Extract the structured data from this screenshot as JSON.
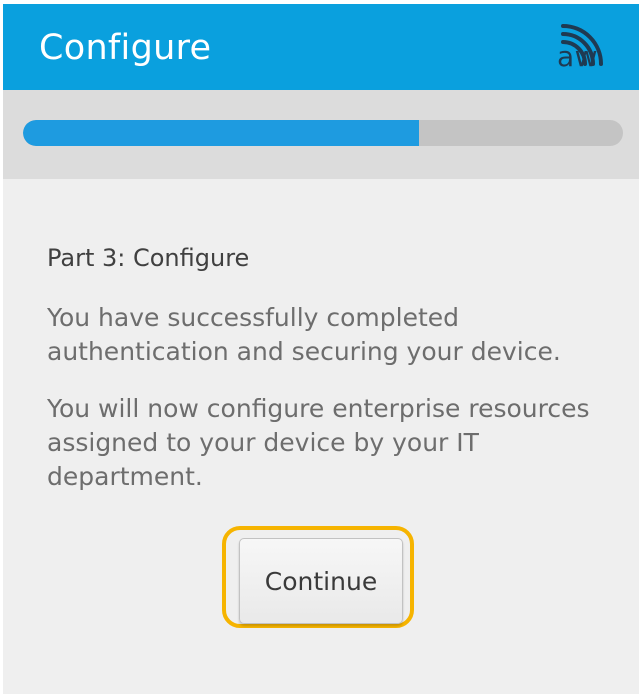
{
  "appbar": {
    "title": "Configure",
    "logo_text": "aw",
    "logo_icon": "airwatch-wifi-logo",
    "background_color": "#0aa0de"
  },
  "progress": {
    "value_fraction": 0.66,
    "fill_color": "#1e9be0",
    "track_color": "#c4c4c4"
  },
  "content": {
    "heading": "Part 3: Configure",
    "paragraph_1": "You have successfully completed authentication and securing your device.",
    "paragraph_2": "You will now configure enterprise resources assigned to your device by your IT department."
  },
  "actions": {
    "continue_label": "Continue",
    "highlight_color": "#f6b400"
  }
}
